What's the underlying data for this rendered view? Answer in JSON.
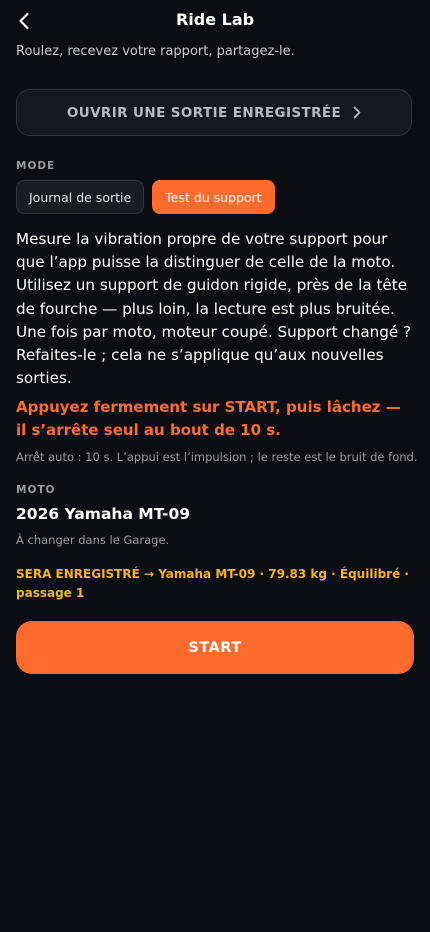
{
  "header": {
    "title": "Ride Lab",
    "back_icon": "chevron-left-icon"
  },
  "subtitle": "Roulez, recevez votre rapport, partagez-le.",
  "open_ride": {
    "label": "OUVRIR UNE SORTIE ENREGISTRÉE",
    "icon": "chevron-right-icon"
  },
  "mode": {
    "label": "MODE",
    "options": [
      {
        "label": "Journal de sortie",
        "selected": false
      },
      {
        "label": "Test du support",
        "selected": true
      }
    ]
  },
  "description": "Mesure la vibration propre de votre support pour que l’app puisse la distinguer de celle de la moto. Utilisez un support de guidon rigide, près de la tête de fourche — plus loin, la lecture est plus bruitée. Une fois par moto, moteur coupé. Support changé ? Refaites-le ; cela ne s’applique qu’aux nouvelles sorties.",
  "instruction": "Appuyez fermement sur START, puis lâchez — il s’arrête seul au bout de 10 s.",
  "autostop_note": "Arrêt auto : 10 s. L’appui est l’impulsion ; le reste est le bruit de fond.",
  "moto": {
    "label": "MOTO",
    "name": "2026 Yamaha MT-09",
    "hint": "À changer dans le Garage."
  },
  "record_info": "SERA ENREGISTRÉ → Yamaha MT-09 · 79.83 kg · Équilibré · passage 1",
  "start": {
    "label": "START"
  },
  "colors": {
    "background": "#0c0d12",
    "accent": "#ff6b2c",
    "highlight": "#f3b51d"
  }
}
